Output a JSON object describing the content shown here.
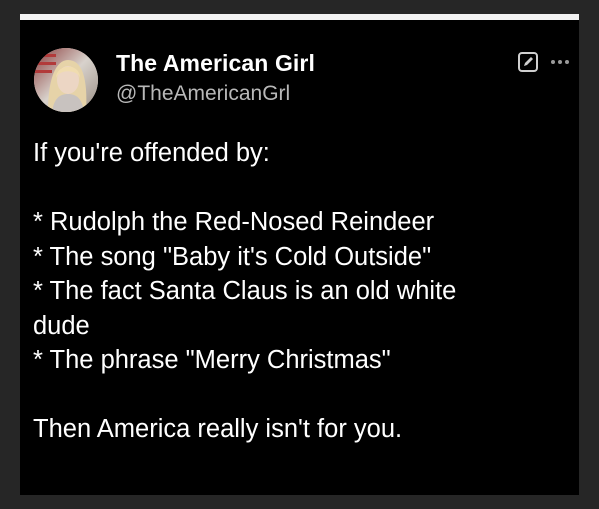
{
  "tweet": {
    "author": {
      "display_name": "The American Girl",
      "handle": "@TheAmericanGrl",
      "avatar_icon": "profile-photo"
    },
    "icons": {
      "edit": "edit-icon",
      "more": "more-icon"
    },
    "text_lines": [
      "If you're offended by:",
      "",
      "* Rudolph the Red-Nosed Reindeer",
      "* The song \"Baby it's Cold Outside\"",
      "* The fact Santa Claus is an old white",
      "dude",
      "* The phrase \"Merry Christmas\"",
      "",
      "Then America really isn't for you."
    ]
  },
  "colors": {
    "background": "#000000",
    "text": "#ffffff",
    "handle": "#b8b8b8",
    "frame": "#262626"
  }
}
